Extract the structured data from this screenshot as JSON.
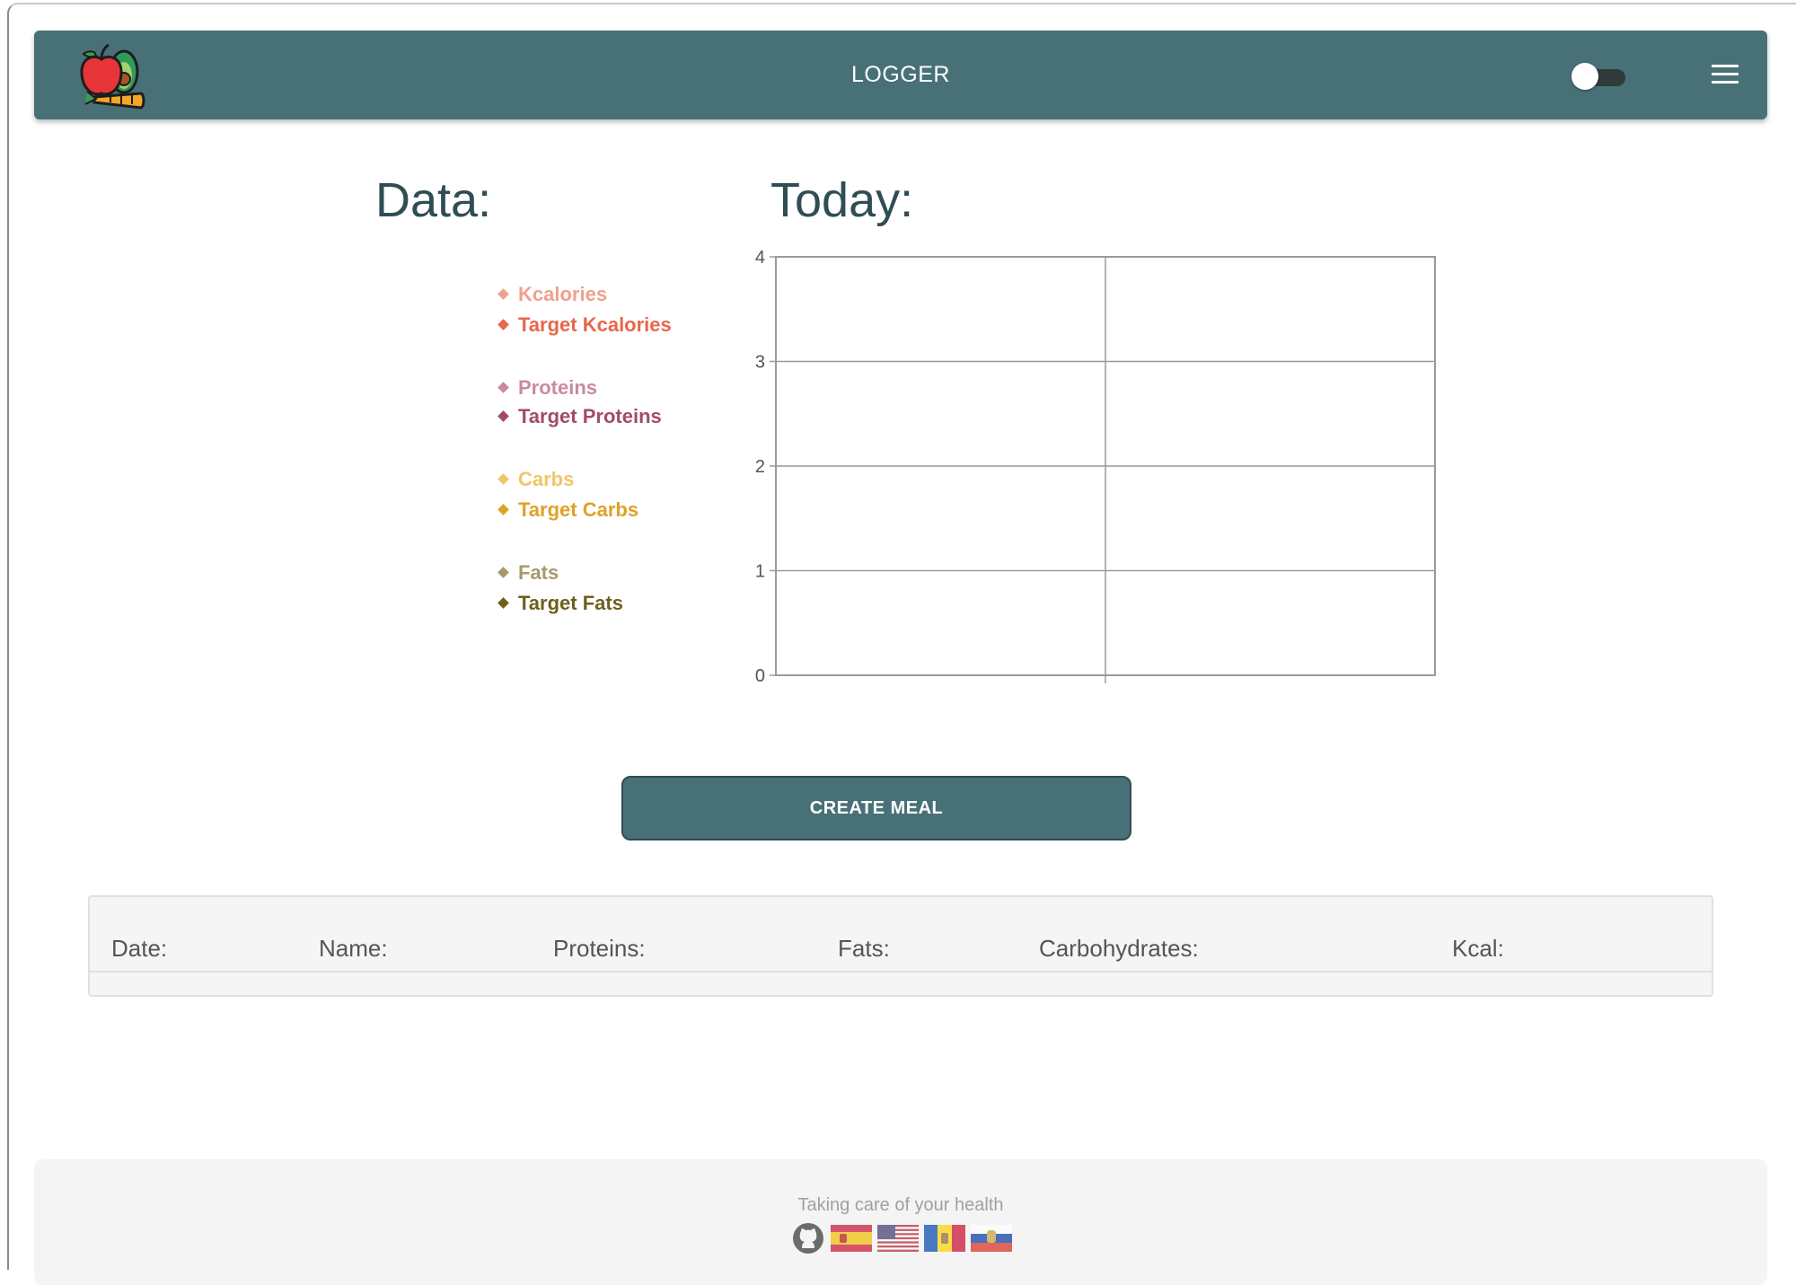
{
  "navbar": {
    "title": "LOGGER",
    "logo_icon": "fruit-logo-icon",
    "toggle_state": "off",
    "menu_icon": "hamburger-menu-icon",
    "bg_color": "#487177"
  },
  "headings": {
    "data": "Data:",
    "today": "Today:"
  },
  "legend": [
    {
      "label": "Kcalories",
      "color": "#f0a08c"
    },
    {
      "label": "Target Kcalories",
      "color": "#e8674c"
    },
    {
      "label": "Proteins",
      "color": "#c98aa2"
    },
    {
      "label": "Target Proteins",
      "color": "#a24a6e"
    },
    {
      "label": "Carbs",
      "color": "#f2c56a"
    },
    {
      "label": "Target Carbs",
      "color": "#e0a12a"
    },
    {
      "label": "Fats",
      "color": "#a69a6a"
    },
    {
      "label": "Target Fats",
      "color": "#6e5f1e"
    }
  ],
  "chart_data": {
    "type": "bar",
    "title": "",
    "categories": [],
    "series": [],
    "xlabel": "",
    "ylabel": "",
    "ylim": [
      0,
      4
    ],
    "yticks": [
      "0",
      "1",
      "2",
      "3",
      "4"
    ],
    "grid": true,
    "legend_placement": "left"
  },
  "create_meal_label": "CREATE MEAL",
  "table": {
    "headers": [
      "Date:",
      "Name:",
      "Proteins:",
      "Fats:",
      "Carbohydrates:",
      "Kcal:"
    ],
    "rows": []
  },
  "footer": {
    "tagline": "Taking care of your health",
    "icons": [
      "github-icon",
      "spain-flag-icon",
      "usa-flag-icon",
      "moldova-flag-icon",
      "russia-flag-icon"
    ]
  }
}
